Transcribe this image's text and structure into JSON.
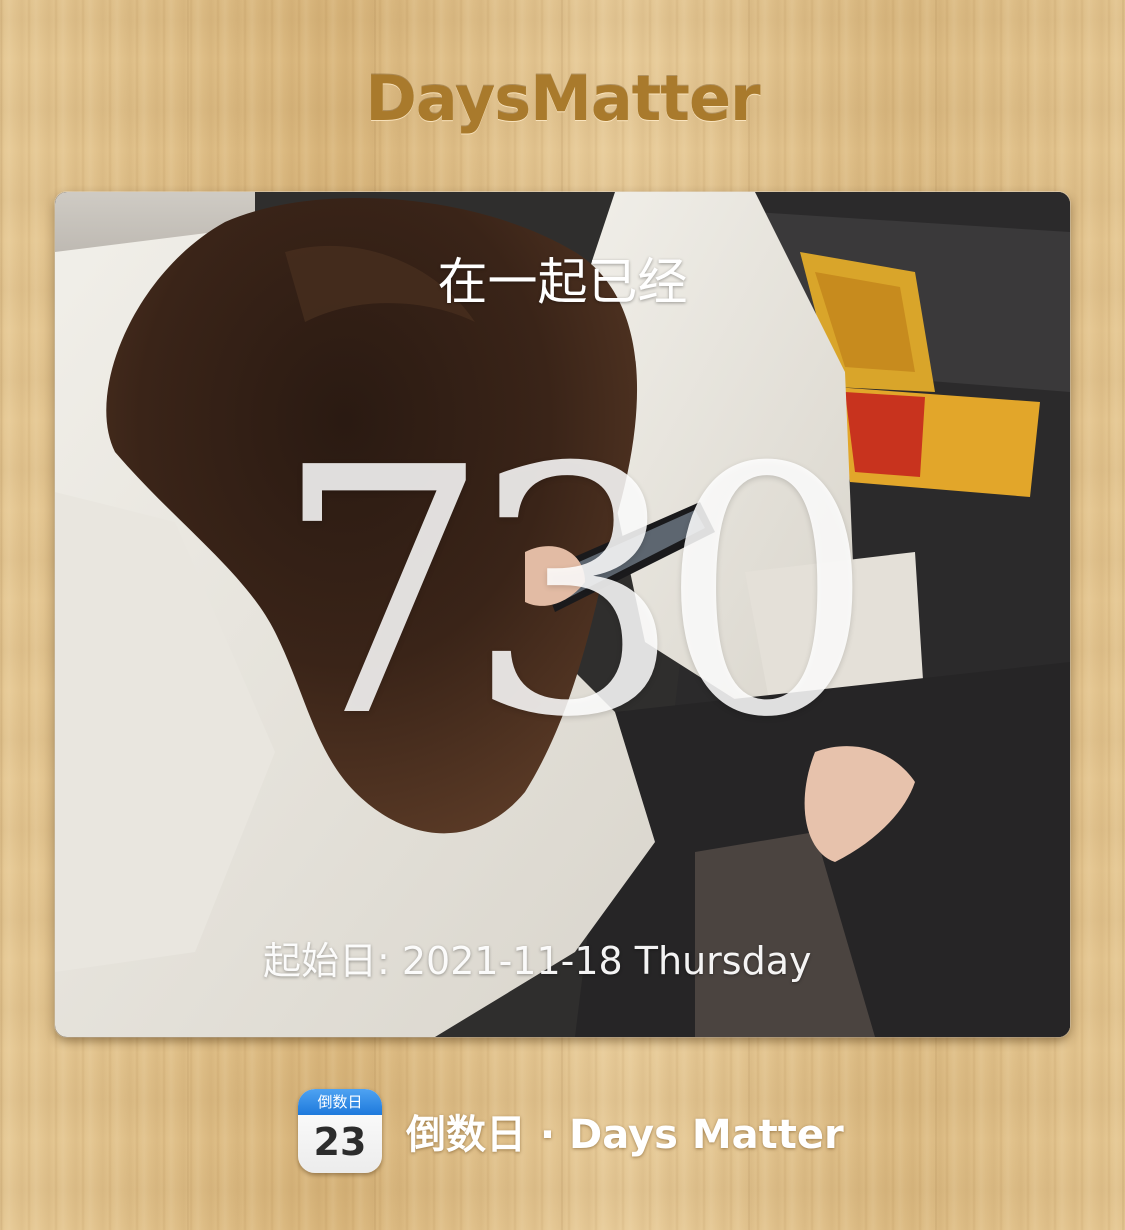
{
  "app": {
    "title": "DaysMatter"
  },
  "event_card": {
    "heading": "在一起已经",
    "days": "730",
    "start_label": "起始日: 2021-11-18 Thursday",
    "photo_alt": "background-photo"
  },
  "footer": {
    "icon_label": "倒数日",
    "icon_number": "23",
    "brand_text": "倒数日 · Days Matter"
  },
  "colors": {
    "wood_background": "#e2c48f",
    "title_gold": "#a97a2c",
    "icon_blue": "#1d79dc"
  },
  "icons": [
    "calendar-app-icon"
  ]
}
